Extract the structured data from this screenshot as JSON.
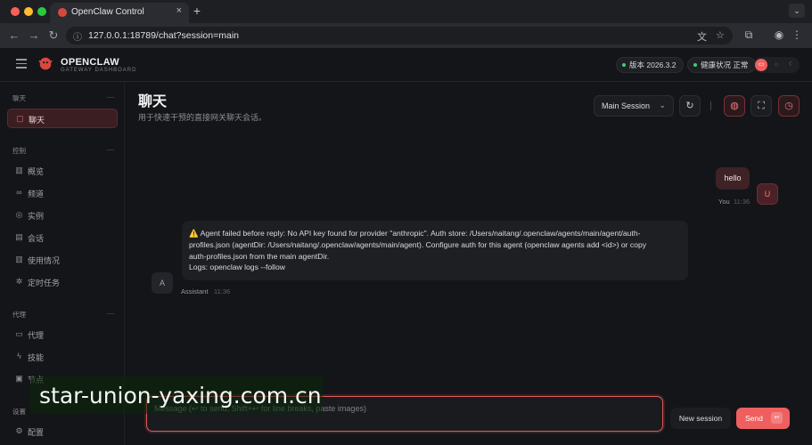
{
  "browser": {
    "tab_title": "OpenClaw Control",
    "tab_close": "×",
    "new_tab": "+",
    "url": "127.0.0.1:18789/chat?session=main",
    "traffic_colors": [
      "#ff5f57",
      "#febc2e",
      "#28c840"
    ]
  },
  "header": {
    "brand": "OPENCLAW",
    "brand_sub": "GATEWAY DASHBOARD",
    "version_pill": "版本 2026.3.2",
    "health_pill": "健康状况 正常",
    "accent": "#ef5f5f"
  },
  "sidebar": {
    "groups": [
      {
        "label": "聊天",
        "items": [
          {
            "label": "聊天",
            "icon": "message-icon",
            "active": true
          }
        ]
      },
      {
        "label": "控制",
        "items": [
          {
            "label": "概览",
            "icon": "bar-chart-icon"
          },
          {
            "label": "频道",
            "icon": "link-icon"
          },
          {
            "label": "实例",
            "icon": "radio-icon"
          },
          {
            "label": "会话",
            "icon": "document-icon"
          },
          {
            "label": "使用情况",
            "icon": "bar-chart-icon"
          },
          {
            "label": "定时任务",
            "icon": "loader-icon"
          }
        ]
      },
      {
        "label": "代理",
        "items": [
          {
            "label": "代理",
            "icon": "folder-icon"
          },
          {
            "label": "技能",
            "icon": "zap-icon"
          },
          {
            "label": "节点",
            "icon": "monitor-icon"
          }
        ]
      },
      {
        "label": "设置",
        "items": [
          {
            "label": "配置",
            "icon": "settings-icon"
          }
        ]
      }
    ]
  },
  "main": {
    "title": "聊天",
    "subtitle": "用于快速干预的直接网关聊天会话。",
    "session_select": "Main Session"
  },
  "messages": {
    "user": {
      "text": "hello",
      "avatar": "U",
      "name": "You",
      "time": "11:36"
    },
    "assistant": {
      "lines": [
        "⚠️ Agent failed before reply: No API key found for provider \"anthropic\". Auth store: /Users/naitang/.openclaw/agents/main/agent/auth-",
        "profiles.json (agentDir: /Users/naitang/.openclaw/agents/main/agent). Configure auth for this agent (openclaw agents add <id>) or copy",
        "auth-profiles.json from the main agentDir.",
        "Logs: openclaw logs --follow"
      ],
      "avatar": "A",
      "name": "Assistant",
      "time": "11:36"
    }
  },
  "compose": {
    "placeholder": "Message (↩ to send, Shift+↩ for line breaks, paste images)",
    "new_session": "New session",
    "send": "Send",
    "send_kbd": "↩"
  },
  "watermark": "star-union-yaxing.com.cn"
}
